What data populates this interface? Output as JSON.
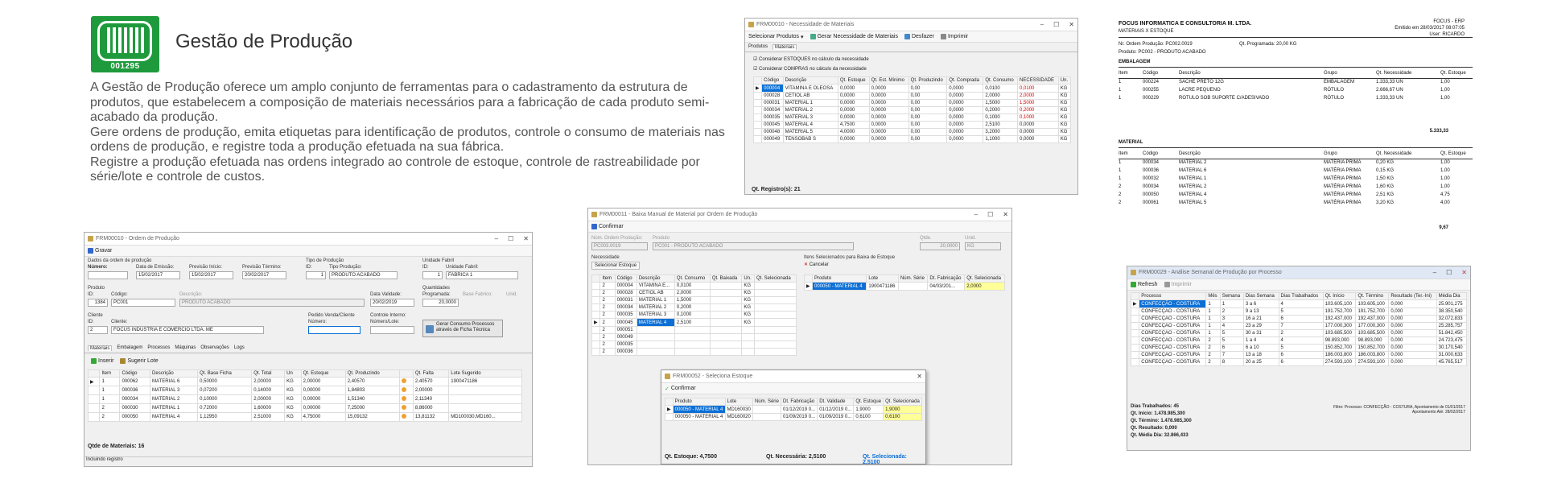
{
  "brand": {
    "logo_number": "001295",
    "title": "Gestão de Produção"
  },
  "description": [
    "A Gestão de Produção oferece um amplo conjunto de ferramentas para o cadastramento da estrutura de produtos, que estabelecem a composição de materiais necessários para a fabricação de cada produto semi-acabado da produção.",
    "Gere ordens de produção, emita etiquetas para identificação de produtos, controle o consumo de materiais nas ordens de produção, e registre toda a produção efetuada na sua fábrica.",
    "Registre a produção efetuada nas ordens integrado ao controle de estoque, controle de rastreabilidade por série/lote e controle de custos."
  ],
  "necessidade": {
    "title": "FRM00010 - Necessidade de Materiais",
    "toolbar": [
      "Selecionar Produtos",
      "Gerar Necessidade de Materiais",
      "Desfazer",
      "Imprimir"
    ],
    "tabs": [
      "Produtos",
      "Materiais"
    ],
    "checks": [
      "Considerar ESTOQUES no cálculo da necessidade",
      "Considerar COMPRAS no cálculo da necessidade"
    ],
    "columns": [
      "Código",
      "Descrição",
      "Qt. Estoque",
      "Qt. Est. Mínimo",
      "Qt. Produzindo",
      "Qt. Comprada",
      "Qt. Consumo",
      "NECESSIDADE",
      "Un."
    ],
    "rows": [
      [
        "000004",
        "VITAMINA E OLEOSA",
        "0,0000",
        "0,0000",
        "0,00",
        "0,0000",
        "0,0100",
        "0,0100",
        "KG"
      ],
      [
        "000028",
        "CETIOL AB",
        "0,0000",
        "0,0000",
        "0,00",
        "0,0000",
        "2,0000",
        "2,0000",
        "KG"
      ],
      [
        "000031",
        "MATERIAL 1",
        "0,0000",
        "0,0000",
        "0,00",
        "0,0000",
        "1,5000",
        "1,5000",
        "KG"
      ],
      [
        "000034",
        "MATERIAL 2",
        "0,0000",
        "0,0000",
        "0,00",
        "0,0000",
        "0,2000",
        "0,2000",
        "KG"
      ],
      [
        "000035",
        "MATERIAL 3",
        "0,0000",
        "0,0000",
        "0,00",
        "0,0000",
        "0,1000",
        "0,1000",
        "KG"
      ],
      [
        "000045",
        "MATERIAL 4",
        "4,7500",
        "0,0000",
        "0,00",
        "0,0000",
        "2,5100",
        "0,0000",
        "KG"
      ],
      [
        "000048",
        "MATERIAL 5",
        "4,0000",
        "0,0000",
        "0,00",
        "0,0000",
        "3,2000",
        "0,0000",
        "KG"
      ],
      [
        "000049",
        "TENSOBAB S",
        "0,0000",
        "0,0000",
        "0,00",
        "0,0000",
        "1,1000",
        "0,0000",
        "KG"
      ]
    ],
    "footer": "Qt. Registro(s): 21"
  },
  "report": {
    "company": "FOCUS INFORMATICA E CONSULTORIA M. LTDA.",
    "subtitle": "MATERIAIS X ESTOQUE",
    "system": "FOCUS - ERP",
    "emitido": "Emitido em 28/03/2017 08:07:05",
    "user": "User: RICARDO",
    "ordem": "Nr. Ordem Produção:  PC002.0019",
    "qt_prog": "Qt. Programada:      20,00 KG",
    "produto": "Produto:     PC002 - PRODUTO ACABADO",
    "sec1": "EMBALAGEM",
    "sec2": "MATERIAL",
    "cols": [
      "Item",
      "Código",
      "Descrição",
      "Grupo",
      "Qt. Necessidade",
      "Qt. Estoque"
    ],
    "rows1": [
      [
        "1",
        "000224",
        "SACHE PRETO 12G",
        "EMBALAGEM",
        "1.333,33  UN",
        "1,00"
      ],
      [
        "1",
        "000255",
        "LACRE PEQUENO",
        "RÓTULO",
        "2.666,67  UN",
        "1,00"
      ],
      [
        "1",
        "000229",
        "ROTULO SOB SUPORTE C/ADESIVADO",
        "RÓTULO",
        "1.333,33  UN",
        "1,00"
      ]
    ],
    "total1": "5.333,33",
    "rows2": [
      [
        "1",
        "000034",
        "MATERIAL 2",
        "MATÉRIA PRIMA",
        "0,20  KG",
        "1,00"
      ],
      [
        "1",
        "000036",
        "MATERIAL 6",
        "MATÉRIA PRIMA",
        "0,15  KG",
        "1,00"
      ],
      [
        "1",
        "000032",
        "MATERIAL 1",
        "MATÉRIA PRIMA",
        "1,50  KG",
        "1,00"
      ],
      [
        "2",
        "000034",
        "MATERIAL 2",
        "MATÉRIA PRIMA",
        "1,60  KG",
        "1,00"
      ],
      [
        "2",
        "000050",
        "MATERIAL 4",
        "MATÉRIA PRIMA",
        "2,51  KG",
        "4,75"
      ],
      [
        "2",
        "000061",
        "MATERIAL 5",
        "MATÉRIA PRIMA",
        "3,20  KG",
        "4,00"
      ]
    ],
    "total2": "9,67"
  },
  "ordem": {
    "title": "FRM00010 - Ordem de Produção",
    "save": "Gravar",
    "group": "Dados da ordem de produção",
    "labels": [
      "Número:",
      "Data de Emissão:",
      "Previsão Início:",
      "Previsão Término:",
      "Tipo de Produção",
      "ID:",
      "Tipo Produção:",
      "Unidade Fabril",
      "ID:",
      "Unidade Fabril:"
    ],
    "values": [
      "",
      "15/02/2017",
      "15/02/2017",
      "20/02/2017",
      "1",
      "PRODUTO ACABADO",
      "1",
      "FABRICA 1"
    ],
    "produto_labels": [
      "Produto",
      "ID:",
      "Código:",
      "Descrição:",
      "Data Validade:",
      "Quantidades",
      "Programada:",
      "Base Fabrico:",
      "Unid."
    ],
    "produto_values": [
      "1384",
      "PC001",
      "PRODUTO ACABADO",
      "20/02/2019",
      "20,0000"
    ],
    "cliente_labels": [
      "Cliente",
      "ID:",
      "Cliente:",
      "Pedido Venda/Cliente",
      "Número:",
      "Controle Interno:",
      "Número/Lote:"
    ],
    "cliente_values": [
      "2",
      "FOCUS INDUSTRIA E COMERCIO LTDA. ME"
    ],
    "gerar": "Gerar Consumo Processos através de Ficha Técnica",
    "tabs": [
      "Materiais",
      "Embalagem",
      "Processos",
      "Máquinas",
      "Observações",
      "Logs"
    ],
    "actions": [
      "Inserir",
      "Sugerir Lote"
    ],
    "columns": [
      "Item",
      "Código",
      "Descrição",
      "Qt. Base Ficha",
      "Qt. Total",
      "Un",
      "Qt. Estoque",
      "Qt. Produzindo",
      "",
      "Qt. Falta",
      "Lote Sugerido"
    ],
    "rows": [
      [
        "1",
        "000062",
        "MATERIAL 6",
        "0,50000",
        "2,00000",
        "KG",
        "2,00000",
        "2,40570",
        "",
        "2,40570",
        "1900471186"
      ],
      [
        "1",
        "000036",
        "MATERIAL 3",
        "0,07200",
        "0,14000",
        "KG",
        "0,00000",
        "1,84803",
        "",
        "2,00000",
        ""
      ],
      [
        "1",
        "000034",
        "MATERIAL 2",
        "0,10000",
        "2,00000",
        "KG",
        "0,00000",
        "1,51340",
        "",
        "2,11340",
        ""
      ],
      [
        "2",
        "000030",
        "MATERIAL 1",
        "0,72000",
        "1,60000",
        "KG",
        "0,00000",
        "7,25000",
        "",
        "8,86000",
        ""
      ],
      [
        "2",
        "000050",
        "MATERIAL 4",
        "1,12950",
        "2,51000",
        "KG",
        "4,75000",
        "15,09132",
        "",
        "13,81132",
        "MD100030,MD160..."
      ]
    ],
    "footer": "Qtde de Materiais: 16",
    "status": "Incluindo registro"
  },
  "baixa": {
    "title": "FRM00011 - Baixa Manual de Material por Ordem de Produção",
    "confirm": "Confirmar",
    "labels": [
      "Núm. Ordem Produção:",
      "Produto",
      "Qtde.",
      "Unid."
    ],
    "values": [
      "PC003.0019",
      "PC001 - PRODUTO ACABADO",
      "20,0000",
      "KG"
    ],
    "left_title": "Necessidade",
    "right_title": "Itens Selecionados para Baixa de Estoque",
    "left_action": "Selecionar Estoque",
    "right_action": "Cancelar",
    "left_cols": [
      "Item",
      "Código",
      "Descrição",
      "Qt. Consumo",
      "Qt. Baixada",
      "Un.",
      "Qt. Selecionada"
    ],
    "left_rows": [
      [
        "2",
        "000004",
        "VITAMINA E...",
        "0,0100",
        "",
        "KG",
        ""
      ],
      [
        "2",
        "000028",
        "CETIOL AB",
        "2,0000",
        "",
        "KG",
        ""
      ],
      [
        "2",
        "000031",
        "MATERIAL 1",
        "1,5000",
        "",
        "KG",
        ""
      ],
      [
        "2",
        "000034",
        "MATERIAL 2",
        "0,2000",
        "",
        "KG",
        ""
      ],
      [
        "2",
        "000035",
        "MATERIAL 3",
        "0,1000",
        "",
        "KG",
        ""
      ],
      [
        "2",
        "000045",
        "MATERIAL 4",
        "2,5100",
        "",
        "KG",
        ""
      ],
      [
        "2",
        "000051",
        "",
        "",
        "",
        "",
        ""
      ],
      [
        "2",
        "000049",
        "",
        "",
        "",
        "",
        ""
      ],
      [
        "2",
        "000035",
        "",
        "",
        "",
        "",
        ""
      ],
      [
        "2",
        "000036",
        "",
        "",
        "",
        "",
        ""
      ]
    ],
    "right_cols": [
      "Produto",
      "Lote",
      "Núm. Série",
      "Dt. Fabricação",
      "Qt. Selecionada"
    ],
    "right_rows": [
      [
        "000050 - MATERIAL 4",
        "1900471186",
        "",
        "04/03/201...",
        "2,0000"
      ]
    ],
    "popup": {
      "title": "FRM00052 - Seleciona Estoque",
      "confirm": "Confirmar",
      "cols": [
        "Produto",
        "Lote",
        "Núm. Série",
        "Dt. Fabricação",
        "Dt. Validade",
        "Qt. Estoque",
        "Qt. Selecionada"
      ],
      "rows": [
        [
          "000050 - MATERIAL 4",
          "MD160030",
          "",
          "01/12/2019 0...",
          "01/12/2019 0...",
          "1,9000",
          "1,9000"
        ],
        [
          "000050 - MATERIAL 4",
          "MD160020",
          "",
          "01/09/2019 0...",
          "01/09/2019 0...",
          "0,6100",
          "0,6100"
        ]
      ],
      "f1": "Qt. Estoque:  4,7500",
      "f2": "Qt. Necessária:  2,5100",
      "f3": "Qt. Selecionada:  2,5100"
    }
  },
  "analise": {
    "title": "FRM00029 - Análise Semanal de Produção por Processo",
    "toolbar": [
      "Refresh",
      "Imprimir"
    ],
    "cols": [
      "Processo",
      "Mês",
      "Semana",
      "Dias Semana",
      "Dias Trabalhados",
      "Qt. Início",
      "Qt. Término",
      "Resultado (Ter.-Ini)",
      "Média Dia"
    ],
    "rows": [
      [
        "CONFECÇÃO - COSTURA",
        "1",
        "1",
        "3 a 6",
        "4",
        "103.605,100",
        "103.605,100",
        "0,000",
        "25.901,275"
      ],
      [
        "CONFECÇÃO - COSTURA",
        "1",
        "2",
        "9 a 13",
        "5",
        "191.752,700",
        "191.752,700",
        "0,000",
        "38.350,540"
      ],
      [
        "CONFECÇÃO - COSTURA",
        "1",
        "3",
        "16 a 21",
        "6",
        "192.437,000",
        "192.437,000",
        "0,000",
        "32.072,833"
      ],
      [
        "CONFECÇÃO - COSTURA",
        "1",
        "4",
        "23 a 29",
        "7",
        "177.000,300",
        "177.000,300",
        "0,000",
        "25.285,757"
      ],
      [
        "CONFECÇÃO - COSTURA",
        "1",
        "5",
        "30 a 31",
        "2",
        "103.685,500",
        "103.685,500",
        "0,000",
        "51.842,450"
      ],
      [
        "CONFECÇÃO - COSTURA",
        "2",
        "5",
        "1 a 4",
        "4",
        "98.893,000",
        "98.893,000",
        "0,000",
        "24.723,475"
      ],
      [
        "CONFECÇÃO - COSTURA",
        "2",
        "6",
        "6 a 10",
        "5",
        "150.852,700",
        "150.852,700",
        "0,000",
        "30.170,540"
      ],
      [
        "CONFECÇÃO - COSTURA",
        "2",
        "7",
        "13 a 18",
        "6",
        "186.003,800",
        "186.003,800",
        "0,000",
        "31.000,633"
      ],
      [
        "CONFECÇÃO - COSTURA",
        "2",
        "8",
        "20 a 25",
        "6",
        "274.593,100",
        "274.593,100",
        "0,000",
        "45.765,517"
      ]
    ],
    "summary": [
      "Dias Trabalhados:  45",
      "Qt. Início:  1.478.985,300",
      "Qt. Término:  1.478.985,300",
      "Qt. Resultado:  0,000",
      "Qt. Média Dia:  32.866,433"
    ],
    "filter": "Filtro: Processo: CONFECÇÃO - COSTURA, Apontamento de 01/01/2017",
    "filter2": "Apontamento Até: 28/02/2017"
  }
}
